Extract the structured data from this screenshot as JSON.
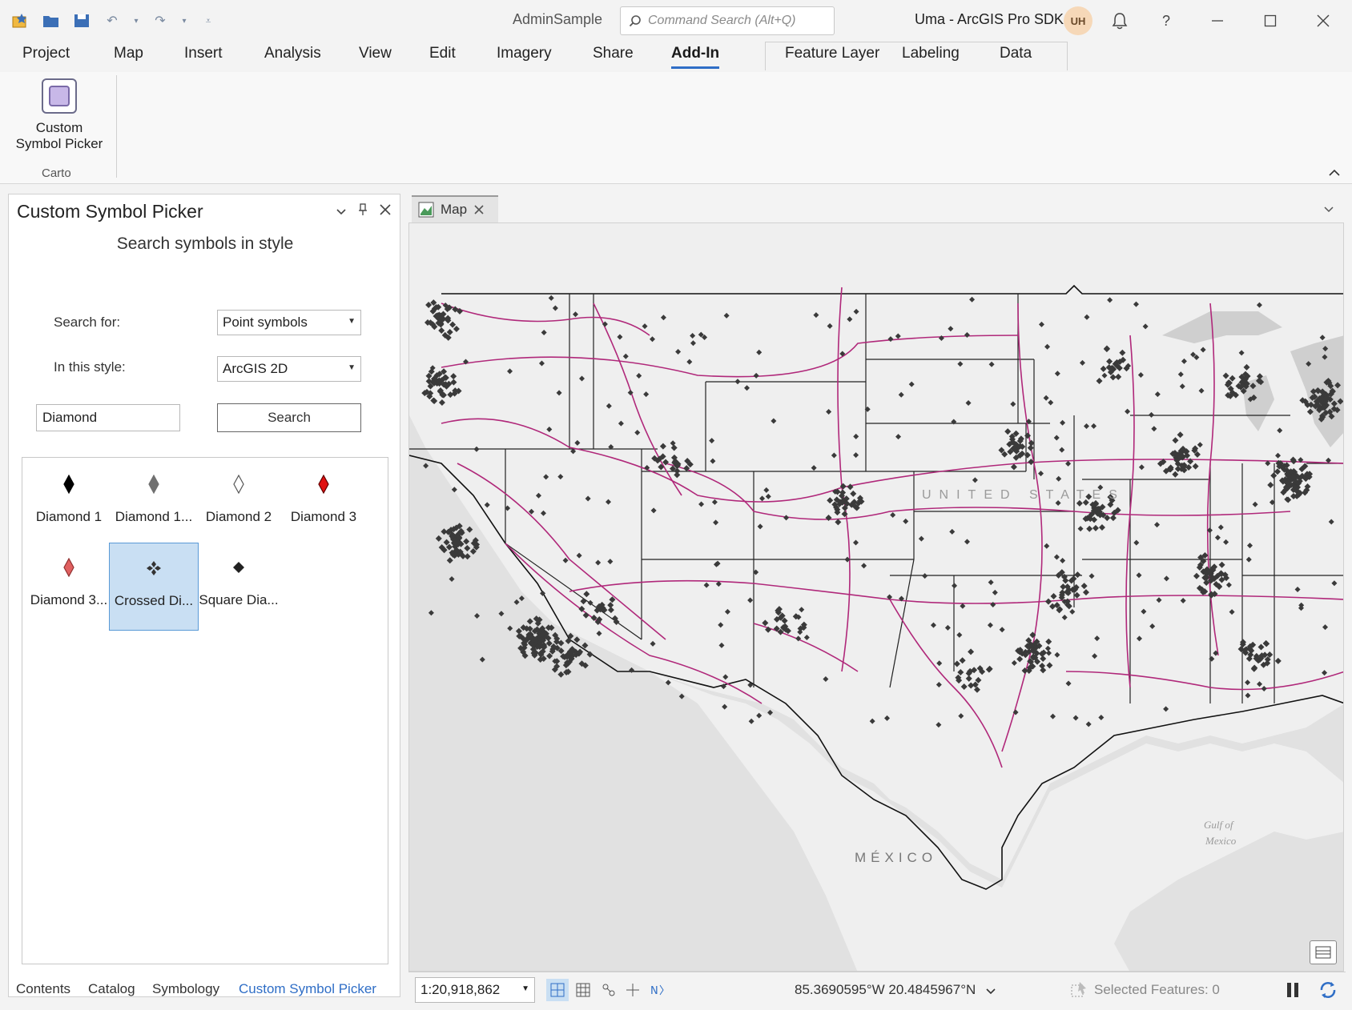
{
  "titlebar": {
    "project_name": "AdminSample",
    "search_placeholder": "Command Search (Alt+Q)",
    "user_label": "Uma - ArcGIS Pro SDK",
    "avatar_initials": "UH",
    "help_label": "?"
  },
  "ribbon": {
    "tabs": [
      "Project",
      "Map",
      "Insert",
      "Analysis",
      "View",
      "Edit",
      "Imagery",
      "Share",
      "Add-In"
    ],
    "active_tab": "Add-In",
    "contextual_tabs": [
      "Feature Layer",
      "Labeling",
      "Data"
    ],
    "button_label_line1": "Custom",
    "button_label_line2": "Symbol Picker",
    "group_label": "Carto"
  },
  "pane": {
    "title": "Custom Symbol Picker",
    "heading": "Search symbols in style",
    "search_for_label": "Search for:",
    "search_for_value": "Point symbols",
    "style_label": "In this style:",
    "style_value": "ArcGIS 2D",
    "search_text": "Diamond",
    "search_button": "Search",
    "gallery": [
      {
        "label": "Diamond 1",
        "fill": "#000000",
        "stroke": "#000000",
        "kind": "diamond"
      },
      {
        "label": "Diamond 1...",
        "fill": "#707070",
        "stroke": "#707070",
        "kind": "diamond"
      },
      {
        "label": "Diamond 2",
        "fill": "#ffffff",
        "stroke": "#555555",
        "kind": "diamond"
      },
      {
        "label": "Diamond 3",
        "fill": "#e01010",
        "stroke": "#600000",
        "kind": "diamond"
      },
      {
        "label": "Diamond 3...",
        "fill": "#e06060",
        "stroke": "#903030",
        "kind": "diamond"
      },
      {
        "label": "Crossed Di...",
        "fill": "#333333",
        "stroke": "#333333",
        "kind": "crossed"
      },
      {
        "label": "Square Dia...",
        "fill": "#222222",
        "stroke": "#222222",
        "kind": "square"
      }
    ],
    "selected_index": 5
  },
  "dock_tabs": [
    "Contents",
    "Catalog",
    "Symbology",
    "Custom Symbol Picker"
  ],
  "active_dock_tab": "Custom Symbol Picker",
  "map": {
    "tab_label": "Map",
    "label_us": "UNITED STATES",
    "label_mexico": "MÉXICO",
    "label_gulf_line1": "Gulf of",
    "label_gulf_line2": "Mexico",
    "road_color": "#b0287a",
    "point_color": "#3a3a3a"
  },
  "statusbar": {
    "scale": "1:20,918,862",
    "coordinates": "85.3690595°W 20.4845967°N",
    "selected_features": "Selected Features: 0"
  }
}
